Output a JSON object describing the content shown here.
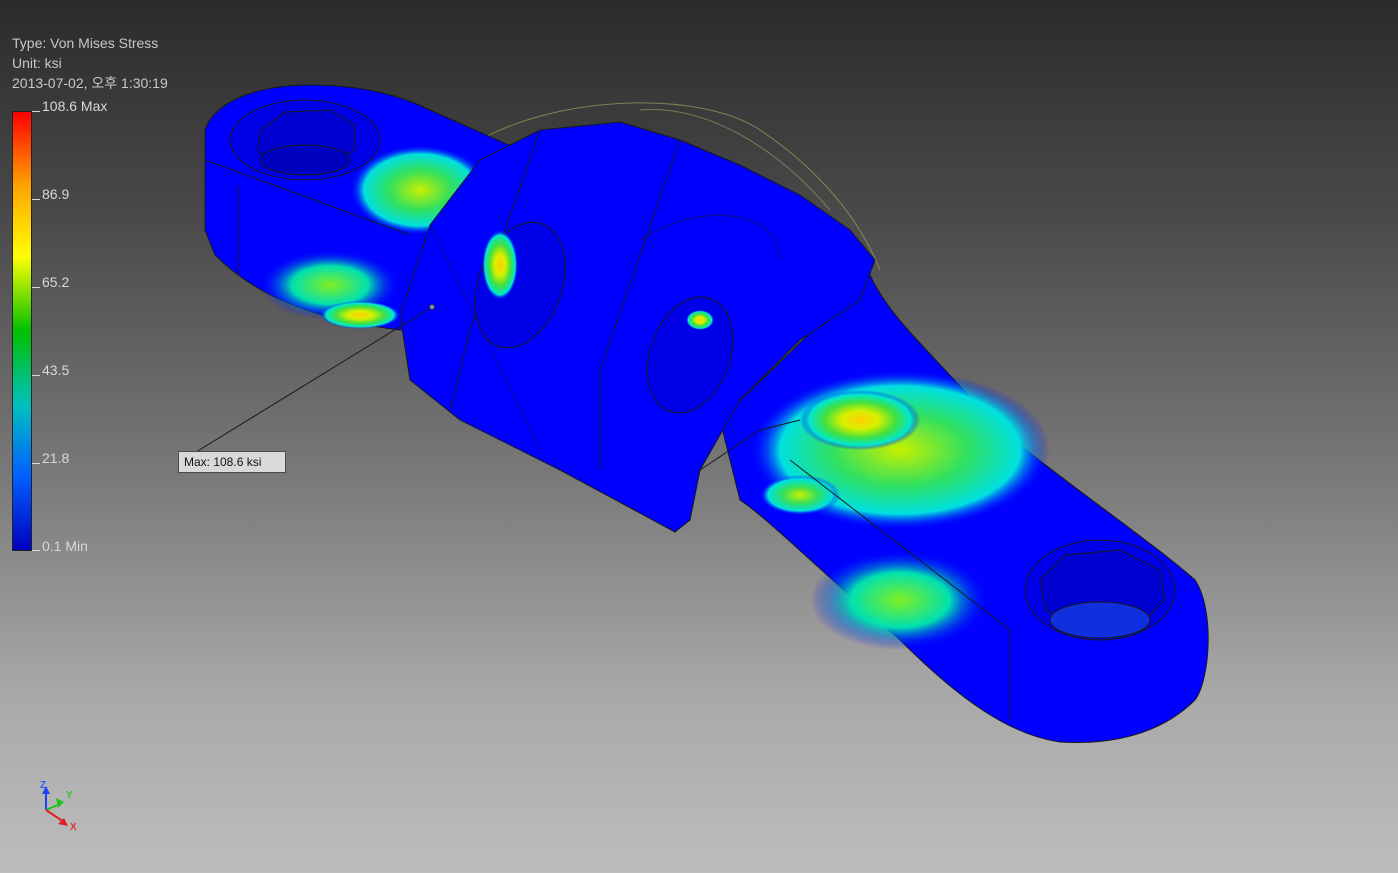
{
  "result": {
    "type_text": "Type: Von Mises Stress",
    "unit_text": "Unit: ksi",
    "timestamp_text": "2013-07-02, 오후 1:30:19"
  },
  "legend": {
    "labels": [
      "108.6 Max",
      "86.9",
      "65.2",
      "43.5",
      "21.8",
      "0.1 Min"
    ],
    "colors": [
      "#ff0000",
      "#ffa500",
      "#ffff00",
      "#00c000",
      "#00c0c0",
      "#0060ff",
      "#0000c0"
    ]
  },
  "probe": {
    "max_label": "Max: 108.6 ksi"
  },
  "triad": {
    "z_label": "Z",
    "y_label": "Y",
    "x_label": "X"
  },
  "colors": {
    "stress_low": "#0000ff",
    "stress_mid": "#00e0a0",
    "stress_high": "#ffe000",
    "edge": "#1a1a1a"
  }
}
